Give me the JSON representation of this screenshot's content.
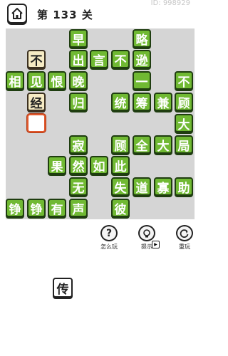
{
  "header": {
    "level_title": "第 133 关",
    "level_id": "ID: 998929"
  },
  "board": {
    "cells": [
      {
        "ch": "早",
        "c": 3,
        "r": 0,
        "t": "green"
      },
      {
        "ch": "略",
        "c": 6,
        "r": 0,
        "t": "green"
      },
      {
        "ch": "不",
        "c": 1,
        "r": 1,
        "t": "cream"
      },
      {
        "ch": "出",
        "c": 3,
        "r": 1,
        "t": "green"
      },
      {
        "ch": "言",
        "c": 4,
        "r": 1,
        "t": "green"
      },
      {
        "ch": "不",
        "c": 5,
        "r": 1,
        "t": "green"
      },
      {
        "ch": "逊",
        "c": 6,
        "r": 1,
        "t": "green"
      },
      {
        "ch": "相",
        "c": 0,
        "r": 2,
        "t": "green"
      },
      {
        "ch": "见",
        "c": 1,
        "r": 2,
        "t": "green"
      },
      {
        "ch": "恨",
        "c": 2,
        "r": 2,
        "t": "green"
      },
      {
        "ch": "晚",
        "c": 3,
        "r": 2,
        "t": "green"
      },
      {
        "ch": "一",
        "c": 6,
        "r": 2,
        "t": "green"
      },
      {
        "ch": "不",
        "c": 8,
        "r": 2,
        "t": "green"
      },
      {
        "ch": "经",
        "c": 1,
        "r": 3,
        "t": "cream"
      },
      {
        "ch": "归",
        "c": 3,
        "r": 3,
        "t": "green"
      },
      {
        "ch": "统",
        "c": 5,
        "r": 3,
        "t": "green"
      },
      {
        "ch": "筹",
        "c": 6,
        "r": 3,
        "t": "green"
      },
      {
        "ch": "兼",
        "c": 7,
        "r": 3,
        "t": "green"
      },
      {
        "ch": "顾",
        "c": 8,
        "r": 3,
        "t": "green"
      },
      {
        "ch": "",
        "c": 1,
        "r": 4,
        "t": "blank"
      },
      {
        "ch": "大",
        "c": 8,
        "r": 4,
        "t": "green"
      },
      {
        "ch": "寂",
        "c": 3,
        "r": 5,
        "t": "green"
      },
      {
        "ch": "顾",
        "c": 5,
        "r": 5,
        "t": "green"
      },
      {
        "ch": "全",
        "c": 6,
        "r": 5,
        "t": "green"
      },
      {
        "ch": "大",
        "c": 7,
        "r": 5,
        "t": "green"
      },
      {
        "ch": "局",
        "c": 8,
        "r": 5,
        "t": "green"
      },
      {
        "ch": "果",
        "c": 2,
        "r": 6,
        "t": "green"
      },
      {
        "ch": "然",
        "c": 3,
        "r": 6,
        "t": "green"
      },
      {
        "ch": "如",
        "c": 4,
        "r": 6,
        "t": "green"
      },
      {
        "ch": "此",
        "c": 5,
        "r": 6,
        "t": "green"
      },
      {
        "ch": "无",
        "c": 3,
        "r": 7,
        "t": "green"
      },
      {
        "ch": "失",
        "c": 5,
        "r": 7,
        "t": "green"
      },
      {
        "ch": "道",
        "c": 6,
        "r": 7,
        "t": "green"
      },
      {
        "ch": "寡",
        "c": 7,
        "r": 7,
        "t": "green"
      },
      {
        "ch": "助",
        "c": 8,
        "r": 7,
        "t": "green"
      },
      {
        "ch": "铮",
        "c": 0,
        "r": 8,
        "t": "green"
      },
      {
        "ch": "铮",
        "c": 1,
        "r": 8,
        "t": "green"
      },
      {
        "ch": "有",
        "c": 2,
        "r": 8,
        "t": "green"
      },
      {
        "ch": "声",
        "c": 3,
        "r": 8,
        "t": "green"
      },
      {
        "ch": "彼",
        "c": 5,
        "r": 8,
        "t": "green"
      }
    ]
  },
  "tools": {
    "how_to_play": {
      "label": "怎么玩",
      "icon": "?"
    },
    "hint": {
      "label": "提示",
      "icon": "lightbulb-icon"
    },
    "replay": {
      "label": "重玩",
      "icon": "replay-icon"
    }
  },
  "candidates": [
    "传"
  ]
}
